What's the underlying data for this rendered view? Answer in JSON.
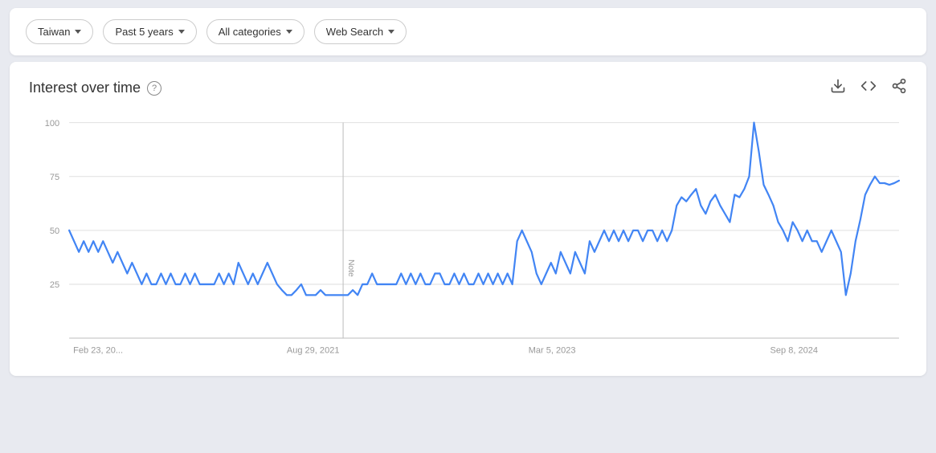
{
  "topbar": {
    "filters": [
      {
        "id": "region",
        "label": "Taiwan"
      },
      {
        "id": "time",
        "label": "Past 5 years"
      },
      {
        "id": "category",
        "label": "All categories"
      },
      {
        "id": "search_type",
        "label": "Web Search"
      }
    ]
  },
  "chart_section": {
    "title": "Interest over time",
    "help_label": "?",
    "actions": [
      {
        "id": "download",
        "symbol": "⬇"
      },
      {
        "id": "embed",
        "symbol": "<>"
      },
      {
        "id": "share",
        "symbol": "↗"
      }
    ],
    "y_labels": [
      "100",
      "75",
      "50",
      "25"
    ],
    "x_labels": [
      "Feb 23, 20...",
      "Aug 29, 2021",
      "Mar 5, 2023",
      "Sep 8, 2024"
    ],
    "note_label": "Note",
    "colors": {
      "line": "#4285f4",
      "grid": "#e0e0e0",
      "axis": "#bdbdbd"
    }
  }
}
